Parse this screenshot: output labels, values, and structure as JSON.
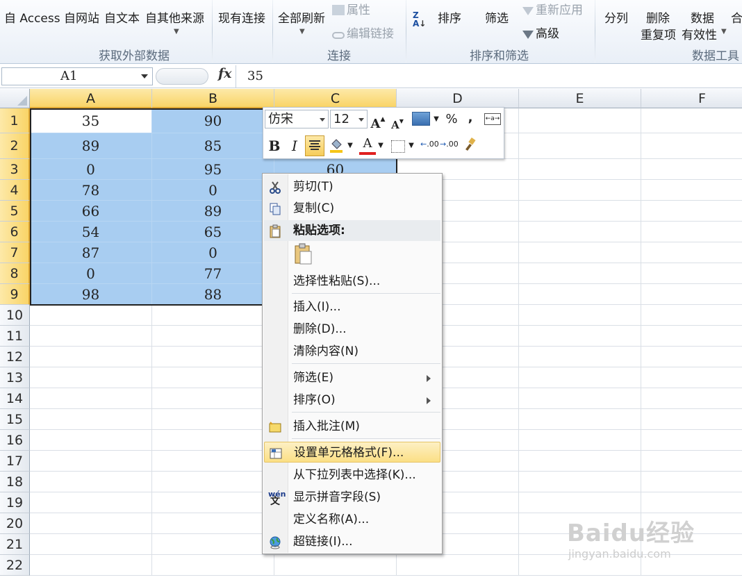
{
  "ribbon": {
    "buttons": {
      "from_access": "自 Access",
      "from_web": "自网站",
      "from_text": "自文本",
      "from_other": "自其他来源",
      "existing_conn": "现有连接",
      "refresh_all": "全部刷新",
      "properties": "属性",
      "edit_links": "编辑链接",
      "sort": "排序",
      "filter": "筛选",
      "reapply": "重新应用",
      "advanced": "高级",
      "text_to_cols": "分列",
      "remove_dup_1": "删除",
      "remove_dup_2": "重复项",
      "validation_1": "数据",
      "validation_2": "有效性",
      "consolidate": "合"
    },
    "groups": {
      "get_external": "获取外部数据",
      "connections": "连接",
      "sort_filter": "排序和筛选",
      "data_tools": "数据工具"
    }
  },
  "formula_bar": {
    "name_box": "A1",
    "fx": "fx",
    "value": "35"
  },
  "sheet": {
    "columns": [
      "A",
      "B",
      "C",
      "D",
      "E",
      "F"
    ],
    "rows": [
      "1",
      "2",
      "3",
      "4",
      "5",
      "6",
      "7",
      "8",
      "9",
      "10",
      "11",
      "12",
      "13",
      "14",
      "15",
      "16",
      "17",
      "18",
      "19",
      "20",
      "21",
      "22"
    ],
    "col_a": [
      "35",
      "89",
      "0",
      "78",
      "66",
      "54",
      "87",
      "0",
      "98"
    ],
    "col_b": [
      "90",
      "85",
      "95",
      "0",
      "89",
      "65",
      "0",
      "77",
      "88"
    ],
    "col_c_visible": "60"
  },
  "mini_toolbar": {
    "font": "仿宋",
    "size": "12",
    "grow_font": "A",
    "shrink_font": "A",
    "percent": "%",
    "comma": ",",
    "bold": "B",
    "italic": "I",
    "font_color": "A",
    "inc_decimal": ".00",
    "dec_decimal": ".00"
  },
  "context_menu": {
    "cut": "剪切(T)",
    "copy": "复制(C)",
    "paste_options": "粘贴选项:",
    "paste_special": "选择性粘贴(S)...",
    "insert": "插入(I)...",
    "delete": "删除(D)...",
    "clear": "清除内容(N)",
    "filter": "筛选(E)",
    "sort": "排序(O)",
    "insert_comment": "插入批注(M)",
    "format_cells": "设置单元格格式(F)...",
    "pick_list": "从下拉列表中选择(K)...",
    "phonetic": "显示拼音字段(S)",
    "define_name": "定义名称(A)...",
    "hyperlink": "超链接(I)..."
  },
  "watermark": {
    "main": "Baidu经验",
    "sub": "jingyan.baidu.com"
  }
}
